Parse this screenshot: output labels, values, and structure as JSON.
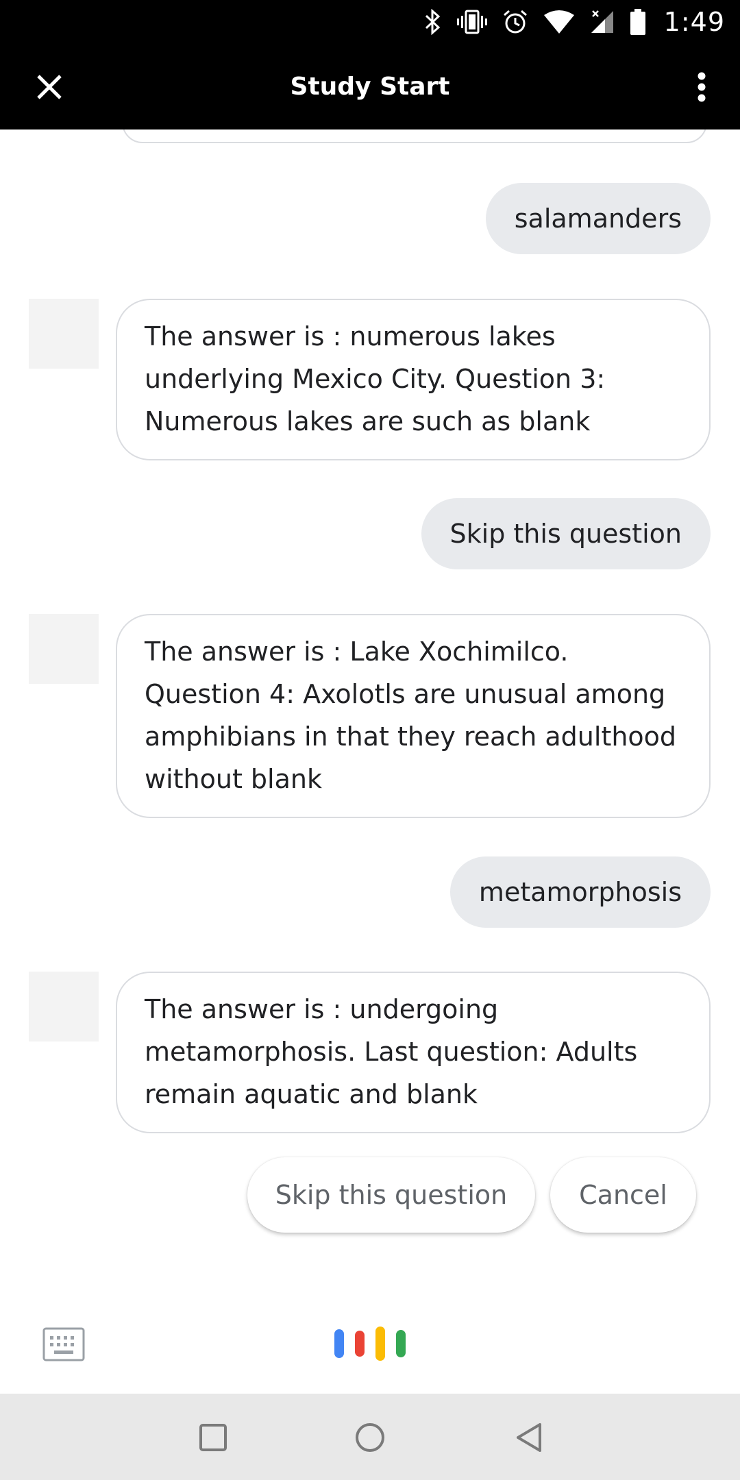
{
  "status_bar": {
    "time": "1:49",
    "icons": [
      "bluetooth-icon",
      "vibrate-icon",
      "alarm-icon",
      "wifi-icon",
      "cell-signal-icon",
      "battery-icon"
    ]
  },
  "app_bar": {
    "title": "Study Start",
    "close_icon": "close-icon",
    "menu_icon": "more-vert-icon"
  },
  "chat": {
    "messages": [
      {
        "from": "user",
        "text": "salamanders"
      },
      {
        "from": "assistant",
        "text": "The answer is : numerous lakes underlying Mexico City. Question 3: Numerous lakes are such as blank"
      },
      {
        "from": "user",
        "text": "Skip this question"
      },
      {
        "from": "assistant",
        "text": "The answer is : Lake Xochimilco. Question 4: Axolotls are unusual among amphibians in that they reach adulthood without blank"
      },
      {
        "from": "user",
        "text": "metamorphosis"
      },
      {
        "from": "assistant",
        "text": "The answer is : undergoing metamorphosis. Last question: Adults remain aquatic and blank"
      }
    ],
    "suggestions": [
      "Skip this question",
      "Cancel"
    ]
  },
  "input_bar": {
    "keyboard_icon": "keyboard-icon",
    "mic_icon": "assistant-mic-icon",
    "mic_colors": [
      "#4285F4",
      "#EA4335",
      "#FBBC05",
      "#34A853"
    ]
  },
  "nav_bar": {
    "icons": [
      "recents-icon",
      "home-icon",
      "back-icon"
    ]
  },
  "colors": {
    "app_bar_bg": "#000000",
    "user_bubble_bg": "#e8eaed",
    "bubble_border": "#dadce0",
    "nav_bg": "#e8e8e8"
  }
}
